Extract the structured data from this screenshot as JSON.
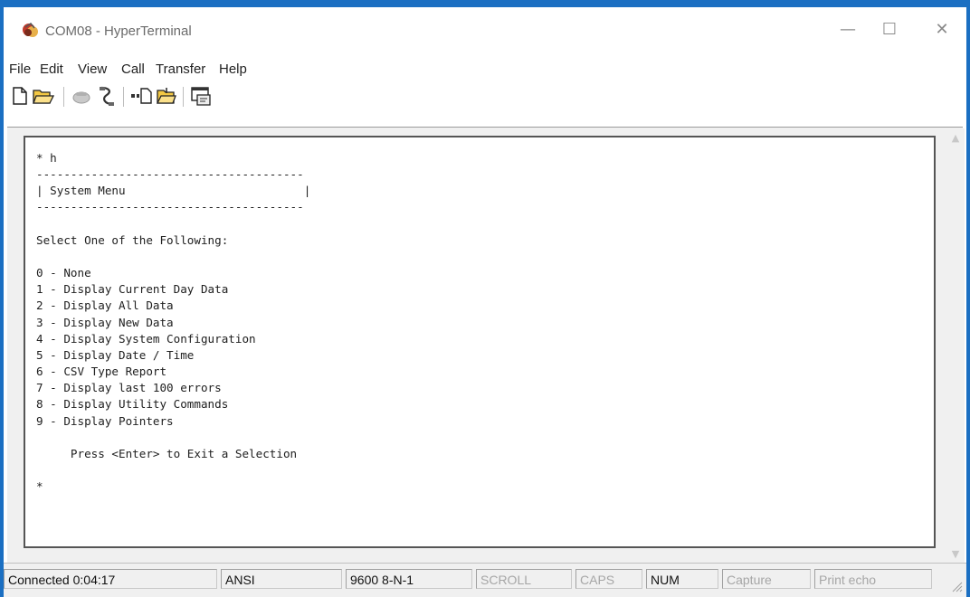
{
  "window": {
    "title": "COM08 - HyperTerminal",
    "controls": {
      "minimize": "—",
      "maximize": "☐",
      "close": "✕"
    }
  },
  "menu": {
    "items": [
      "File",
      "Edit",
      "View",
      "Call",
      "Transfer",
      "Help"
    ]
  },
  "toolbar": {
    "buttons": [
      "new-connection-icon",
      "open-icon",
      "disconnect-icon",
      "dial-icon",
      "send-icon",
      "receive-icon",
      "properties-icon"
    ]
  },
  "terminal": {
    "lines": [
      "* h",
      "---------------------------------------",
      "| System Menu                          |",
      "---------------------------------------",
      "",
      "Select One of the Following:",
      "",
      "0 - None",
      "1 - Display Current Day Data",
      "2 - Display All Data",
      "3 - Display New Data",
      "4 - Display System Configuration",
      "5 - Display Date / Time",
      "6 - CSV Type Report",
      "7 - Display last 100 errors",
      "8 - Display Utility Commands",
      "9 - Display Pointers",
      "",
      "     Press <Enter> to Exit a Selection",
      "",
      "*"
    ]
  },
  "status": {
    "connected": "Connected 0:04:17",
    "emulation": "ANSI",
    "port_settings": "9600 8-N-1",
    "scroll": "SCROLL",
    "caps": "CAPS",
    "num": "NUM",
    "capture": "Capture",
    "print_echo": "Print echo"
  },
  "colors": {
    "frame_blue": "#1b6fc2",
    "status_dim": "#a6a6a6"
  }
}
